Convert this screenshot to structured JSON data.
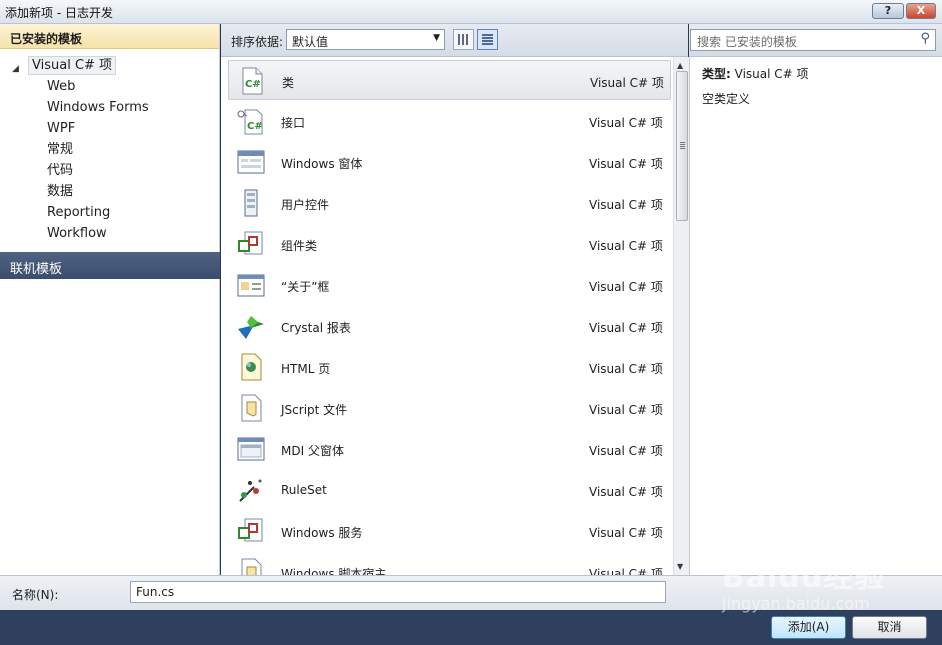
{
  "window": {
    "title": "添加新项 - 日志开发",
    "help_label": "?",
    "close_label": "X"
  },
  "left": {
    "installed_header": "已安装的模板",
    "root": "Visual C# 项",
    "items": [
      "Web",
      "Windows Forms",
      "WPF",
      "常规",
      "代码",
      "数据",
      "Reporting",
      "Workflow"
    ],
    "online_header": "联机模板"
  },
  "toolbar": {
    "sort_label": "排序依据:",
    "sort_value": "默认值"
  },
  "search": {
    "placeholder": "搜索 已安装的模板"
  },
  "templates": [
    {
      "name": "类",
      "category": "Visual C# 项",
      "icon": "class-file-icon"
    },
    {
      "name": "接口",
      "category": "Visual C# 项",
      "icon": "interface-file-icon"
    },
    {
      "name": "Windows 窗体",
      "category": "Visual C# 项",
      "icon": "windows-form-icon"
    },
    {
      "name": "用户控件",
      "category": "Visual C# 项",
      "icon": "user-control-icon"
    },
    {
      "name": "组件类",
      "category": "Visual C# 项",
      "icon": "component-class-icon"
    },
    {
      "name": "“关于”框",
      "category": "Visual C# 项",
      "icon": "about-box-icon"
    },
    {
      "name": "Crystal 报表",
      "category": "Visual C# 项",
      "icon": "crystal-report-icon"
    },
    {
      "name": "HTML 页",
      "category": "Visual C# 项",
      "icon": "html-page-icon"
    },
    {
      "name": "JScript 文件",
      "category": "Visual C# 项",
      "icon": "jscript-file-icon"
    },
    {
      "name": "MDI 父窗体",
      "category": "Visual C# 项",
      "icon": "mdi-form-icon"
    },
    {
      "name": "RuleSet",
      "category": "Visual C# 项",
      "icon": "ruleset-icon"
    },
    {
      "name": "Windows 服务",
      "category": "Visual C# 项",
      "icon": "windows-service-icon"
    },
    {
      "name": "Windows 脚本宿主",
      "category": "Visual C# 项",
      "icon": "script-host-icon"
    }
  ],
  "details": {
    "type_label": "类型:",
    "type_value": "Visual C# 项",
    "description": "空类定义"
  },
  "bottom": {
    "name_label": "名称(N):",
    "name_value": "Fun.cs",
    "add_label": "添加(A)",
    "cancel_label": "取消"
  },
  "watermark": {
    "brand": "Baidu经验",
    "url": "jingyan.baidu.com"
  }
}
